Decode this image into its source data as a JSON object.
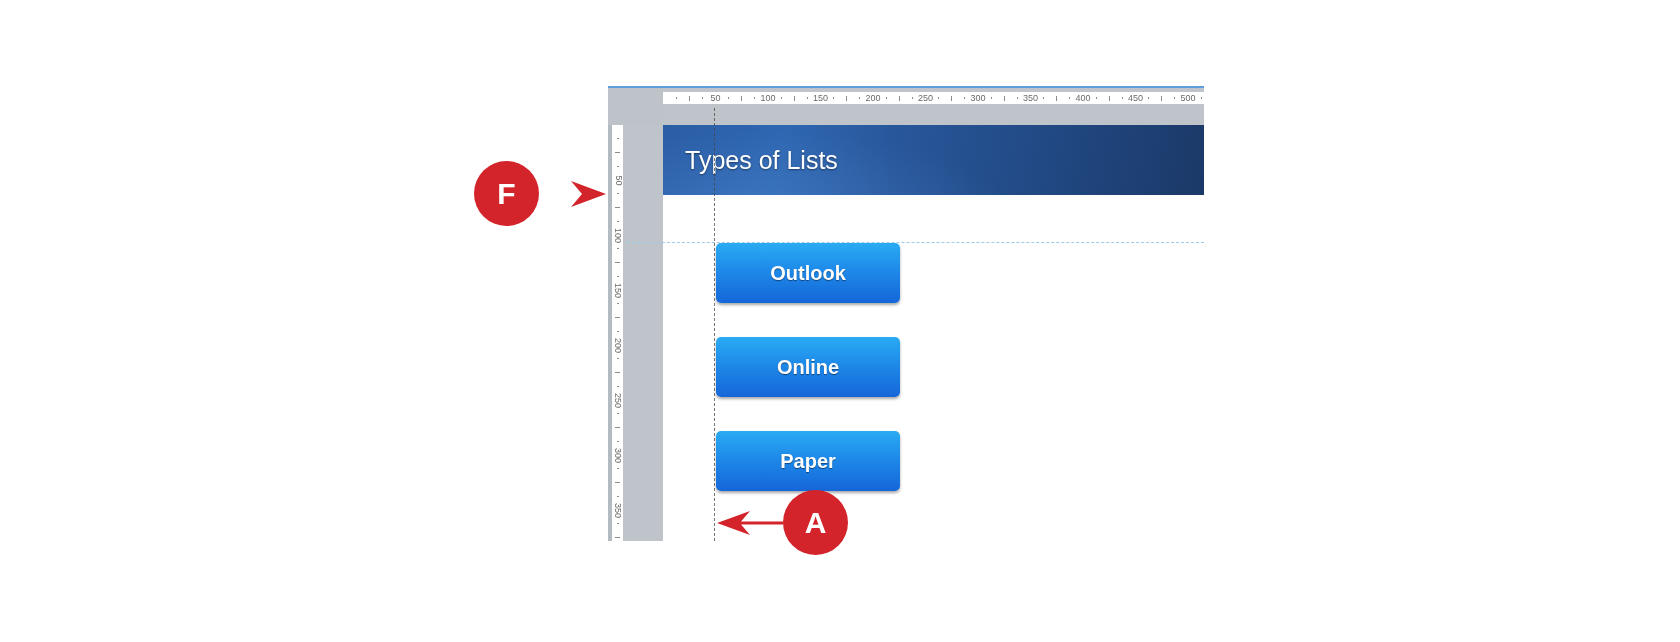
{
  "editor": {
    "horizontal_ruler": {
      "labels": [
        "50",
        "100",
        "150",
        "200",
        "250",
        "300",
        "350",
        "400",
        "450",
        "500"
      ]
    },
    "vertical_ruler": {
      "labels": [
        "50",
        "100",
        "150",
        "200",
        "250",
        "300",
        "350"
      ]
    }
  },
  "slide": {
    "title": "Types of Lists",
    "buttons": [
      "Outlook",
      "Online",
      "Paper"
    ]
  },
  "callouts": [
    {
      "kind": "arrowhead",
      "label": "F"
    },
    {
      "kind": "arrow",
      "label": "A"
    }
  ]
}
